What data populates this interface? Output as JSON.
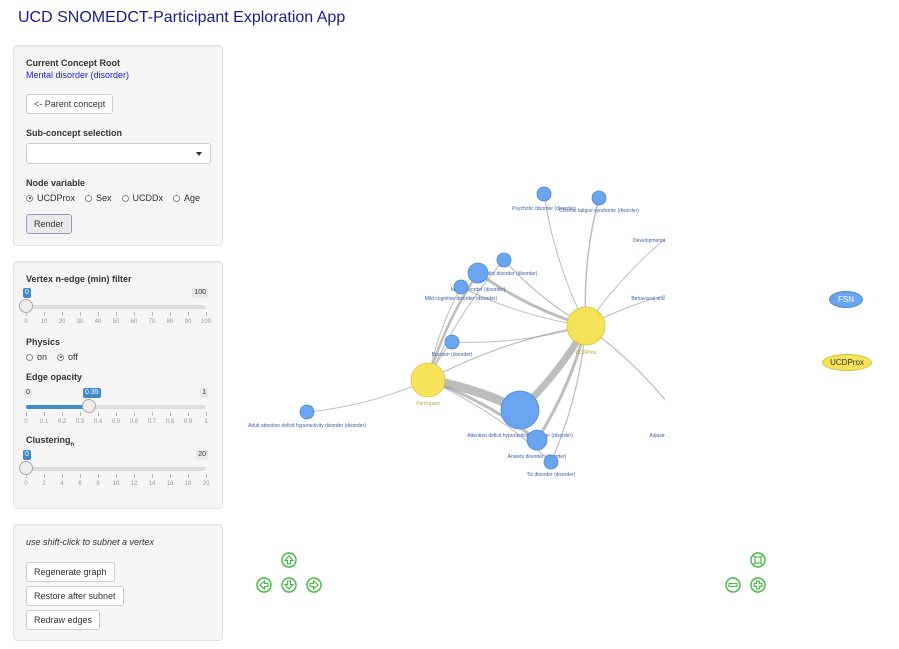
{
  "app": {
    "title": "UCD SNOMEDCT-Participant Exploration App"
  },
  "concept": {
    "root_label": "Current Concept Root",
    "root_value": "Mental disorder (disorder)",
    "parent_button": "<- Parent concept",
    "subconcept_label": "Sub-concept selection",
    "subconcept_value": "",
    "node_variable_label": "Node variable",
    "node_variable_options": [
      "UCDProx",
      "Sex",
      "UCDDx",
      "Age"
    ],
    "node_variable_selected": "UCDProx",
    "render_button": "Render"
  },
  "filters": {
    "vertex_filter": {
      "label": "Vertex n-edge (min) filter",
      "min": 0,
      "max": 100,
      "value": 0,
      "ticks": [
        "0",
        "10",
        "20",
        "30",
        "40",
        "50",
        "60",
        "70",
        "80",
        "90",
        "100"
      ]
    },
    "physics": {
      "label": "Physics",
      "options": [
        "on",
        "off"
      ],
      "selected": "off"
    },
    "edge_opacity": {
      "label": "Edge opacity",
      "min": 0,
      "max": 1,
      "value": 0.35,
      "value_label": "0.35",
      "ticks": [
        "0",
        "0.1",
        "0.2",
        "0.3",
        "0.4",
        "0.5",
        "0.6",
        "0.7",
        "0.8",
        "0.9",
        "1"
      ]
    },
    "clustering": {
      "label": "Clustering",
      "subscript": "n",
      "min": 0,
      "max": 20,
      "value": 0,
      "ticks": [
        "0",
        "2",
        "4",
        "6",
        "8",
        "10",
        "12",
        "14",
        "16",
        "18",
        "20"
      ]
    }
  },
  "actions": {
    "hint": "use shift-click to subnet a vertex",
    "regenerate": "Regenerate graph",
    "restore": "Restore after subnet",
    "redraw": "Redraw edges"
  },
  "legend": {
    "fsn": "FSN",
    "ucdprox": "UCDProx"
  },
  "graph": {
    "colors": {
      "disorder": "#6aa5f0",
      "hub": "#f7e35a",
      "label": "#3b5ea8",
      "hub_label": "#b8a23a",
      "edge": "#9a9a9a"
    },
    "hubs": [
      {
        "id": "ucdprox",
        "label": "UCDProx"
      },
      {
        "id": "participant",
        "label": "Participant"
      }
    ],
    "nodes": [
      {
        "id": "psychotic",
        "label": "Psychotic disorder (disorder)"
      },
      {
        "id": "fatigue",
        "label": "Chronic fatigue syndrome (disorder)"
      },
      {
        "id": "developmental",
        "label": "Developmental mental disorder (disorder)"
      },
      {
        "id": "behavioral",
        "label": "Behavioral and emotional disorder with onset in childhood (dis"
      },
      {
        "id": "personality",
        "label": "Personality disorder (disorder)"
      },
      {
        "id": "mood",
        "label": "Mood disorder (disorder)"
      },
      {
        "id": "mild_cognitive",
        "label": "Mild cognitive disorder (disorder)"
      },
      {
        "id": "bruxism",
        "label": "Bruxism (disorder)"
      },
      {
        "id": "adhd_adult",
        "label": "Adult attention deficit hyperactivity disorder (disorder)"
      },
      {
        "id": "adhd",
        "label": "Attention deficit hyperactivity disorder (disorder)"
      },
      {
        "id": "anxiety",
        "label": "Anxiety disorder (disorder)"
      },
      {
        "id": "tic",
        "label": "Tic disorder (disorder)"
      },
      {
        "id": "adjustment",
        "label": "Adjustment disorder (disorder)"
      }
    ]
  }
}
